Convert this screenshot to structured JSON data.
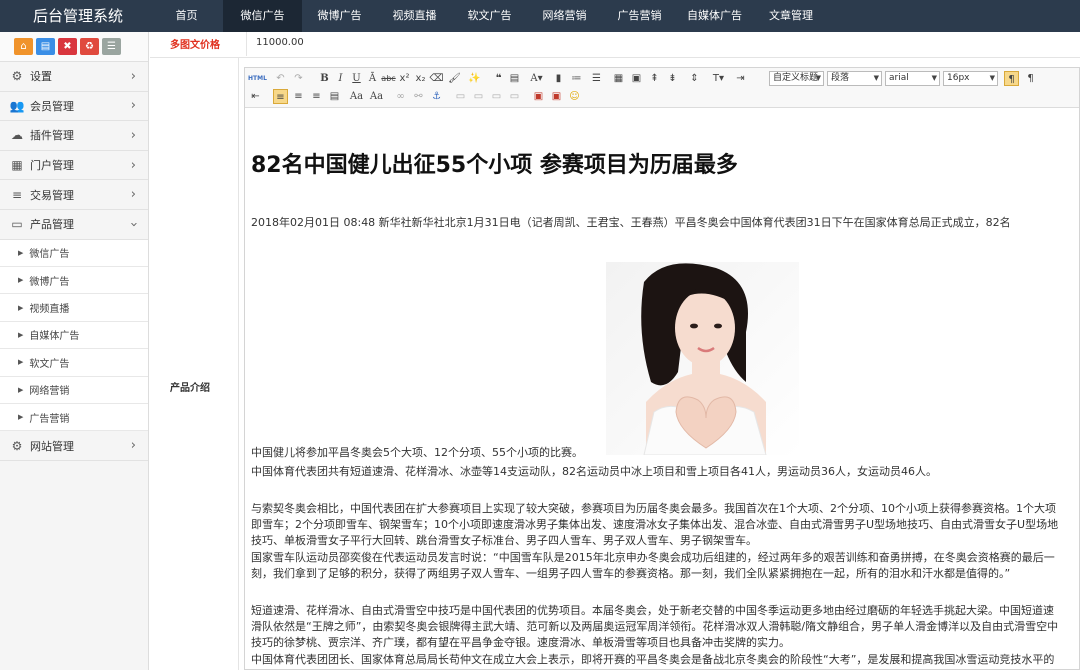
{
  "app": {
    "title": "后台管理系统"
  },
  "topnav": [
    {
      "label": "首页",
      "active": false
    },
    {
      "label": "微信广告",
      "active": true
    },
    {
      "label": "微博广告",
      "active": false
    },
    {
      "label": "视频直播",
      "active": false
    },
    {
      "label": "软文广告",
      "active": false
    },
    {
      "label": "网络营销",
      "active": false
    },
    {
      "label": "广告营销",
      "active": false
    },
    {
      "label": "自媒体广告",
      "active": false
    },
    {
      "label": "文章管理",
      "active": false
    }
  ],
  "shortcuts": [
    {
      "icon": "home-icon",
      "glyph": "⌂",
      "color": "#f0932b"
    },
    {
      "icon": "document-icon",
      "glyph": "▤",
      "color": "#3a8ee6"
    },
    {
      "icon": "trash-icon",
      "glyph": "🗑",
      "color": "#d9363e"
    },
    {
      "icon": "recycle-icon",
      "glyph": "♻",
      "color": "#e04a3e"
    },
    {
      "icon": "list-icon",
      "glyph": "☰",
      "color": "#9aa5a0"
    }
  ],
  "sidebar": {
    "menus": [
      {
        "label": "设置",
        "icon": "gears-icon",
        "glyph": "⚙"
      },
      {
        "label": "会员管理",
        "icon": "users-icon",
        "glyph": "👥"
      },
      {
        "label": "插件管理",
        "icon": "cloud-icon",
        "glyph": "☁"
      },
      {
        "label": "门户管理",
        "icon": "grid-icon",
        "glyph": "▦"
      },
      {
        "label": "交易管理",
        "icon": "bars-icon",
        "glyph": "≡"
      },
      {
        "label": "产品管理",
        "icon": "monitor-icon",
        "glyph": "▭"
      }
    ],
    "subitems": [
      "微信广告",
      "微博广告",
      "视频直播",
      "自媒体广告",
      "软文广告",
      "网络营销",
      "广告营销"
    ],
    "site": {
      "label": "网站管理",
      "icon": "gear-icon",
      "glyph": "⚙"
    }
  },
  "form": {
    "price_label": "多图文价格",
    "price_value": "11000.00",
    "intro_label": "产品介绍"
  },
  "editor": {
    "custom_title": "自定义标题",
    "paragraph": "段落",
    "font": "arial",
    "size": "16px",
    "article": {
      "title": "82名中国健儿出征55个小项 参赛项目为历届最多",
      "p1": "2018年02月01日 08:48 新华社新华社北京1月31日电（记者周凯、王君宝、王春燕）平昌冬奥会中国体育代表团31日下午在国家体育总局正式成立，82名",
      "p2": "中国健儿将参加平昌冬奥会5个大项、12个分项、55个小项的比赛。",
      "p3": "中国体育代表团共有短道速滑、花样滑冰、冰壶等14支运动队，82名运动员中冰上项目和雪上项目各41人，男运动员36人，女运动员46人。",
      "p4": "与索契冬奥会相比，中国代表团在扩大参赛项目上实现了较大突破，参赛项目为历届冬奥会最多。我国首次在1个大项、2个分项、10个小项上获得参赛资格。1个大项即雪车；2个分项即雪车、钢架雪车；10个小项即速度滑冰男子集体出发、速度滑冰女子集体出发、混合冰壶、自由式滑雪男子U型场地技巧、自由式滑雪女子U型场地技巧、单板滑雪女子平行大回转、跳台滑雪女子标准台、男子四人雪车、男子双人雪车、男子钢架雪车。",
      "p5": "国家雪车队运动员邵奕俊在代表运动员发言时说：“中国雪车队是2015年北京申办冬奥会成功后组建的，经过两年多的艰苦训练和奋勇拼搏，在冬奥会资格赛的最后一刻，我们拿到了足够的积分，获得了两组男子双人雪车、一组男子四人雪车的参赛资格。那一刻，我们全队紧紧拥抱在一起，所有的泪水和汗水都是值得的。”",
      "p6": "短道速滑、花样滑冰、自由式滑雪空中技巧是中国代表团的优势项目。本届冬奥会，处于新老交替的中国冬季运动更多地由经过磨砺的年轻选手挑起大梁。中国短道速滑队依然是“王牌之师”，由索契冬奥会银牌得主武大靖、范可新以及两届奥运冠军周洋领衔。花样滑冰双人滑韩聪/隋文静组合，男子单人滑金博洋以及自由式滑雪空中技巧的徐梦桃、贾宗洋、齐广璞，都有望在平昌争金夺银。速度滑冰、单板滑雪等项目也具备冲击奖牌的实力。",
      "p7": "中国体育代表团团长、国家体育总局局长苟仲文在成立大会上表示，即将开赛的平昌冬奥会是备战北京冬奥会的阶段性“大考”，是发展和提高我国冰雪运动竞技水平的重要一环，具有特殊而重要的意义。"
    }
  }
}
